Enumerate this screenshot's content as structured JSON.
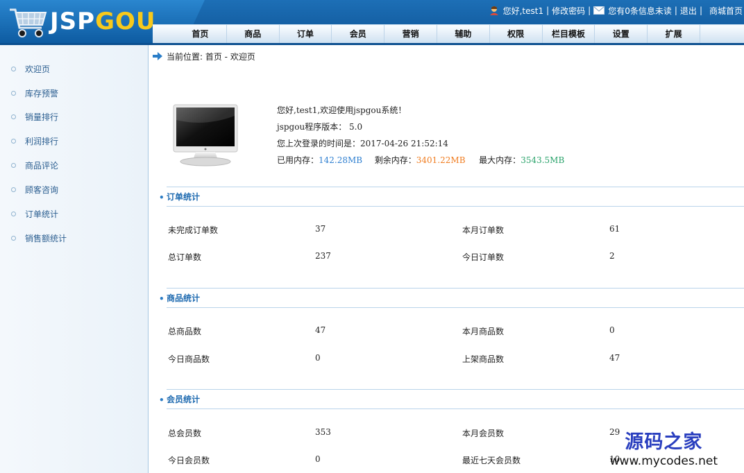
{
  "header": {
    "logo_left": "JSP",
    "logo_right": "GOU",
    "greeting": "您好,test1",
    "change_password": "修改密码",
    "msg_prefix": "您有",
    "msg_count": "0",
    "msg_suffix": "条信息未读",
    "logout": "退出",
    "shop_home": "商城首页"
  },
  "nav": [
    "首页",
    "商品",
    "订单",
    "会员",
    "营销",
    "辅助",
    "权限",
    "栏目模板",
    "设置",
    "扩展"
  ],
  "sidebar": [
    "欢迎页",
    "库存预警",
    "销量排行",
    "利润排行",
    "商品评论",
    "顾客咨询",
    "订单统计",
    "销售额统计"
  ],
  "breadcrumb": "当前位置: 首页 - 欢迎页",
  "welcome": {
    "line1": "您好,test1,欢迎使用jspgou系统！",
    "line2": "jspgou程序版本： 5.0",
    "line3": "您上次登录的时间是：2017-04-26 21:52:14",
    "used_label": "已用内存：",
    "used_value": "142.28MB",
    "free_label": "剩余内存：",
    "free_value": "3401.22MB",
    "max_label": "最大内存：",
    "max_value": "3543.5MB"
  },
  "sections": [
    {
      "title": "订单统计",
      "stats": [
        {
          "label": "未完成订单数",
          "value": "37"
        },
        {
          "label": "本月订单数",
          "value": "61"
        },
        {
          "label": "总订单数",
          "value": "237"
        },
        {
          "label": "今日订单数",
          "value": "2"
        }
      ]
    },
    {
      "title": "商品统计",
      "stats": [
        {
          "label": "总商品数",
          "value": "47"
        },
        {
          "label": "本月商品数",
          "value": "0"
        },
        {
          "label": "今日商品数",
          "value": "0"
        },
        {
          "label": "上架商品数",
          "value": "47"
        }
      ]
    },
    {
      "title": "会员统计",
      "stats": [
        {
          "label": "总会员数",
          "value": "353"
        },
        {
          "label": "本月会员数",
          "value": "29"
        },
        {
          "label": "今日会员数",
          "value": "0"
        },
        {
          "label": "最近七天会员数",
          "value": "10"
        }
      ]
    }
  ],
  "watermark": {
    "cn": "源码之家",
    "url": "www.mycodes.net"
  },
  "colors": {
    "header_blue": "#0e5496",
    "accent_blue": "#1e6ab0",
    "logo_yellow": "#f7c91c",
    "mem_used": "#2e7fd0",
    "mem_free": "#f07c1f",
    "mem_max": "#2aa36b"
  }
}
